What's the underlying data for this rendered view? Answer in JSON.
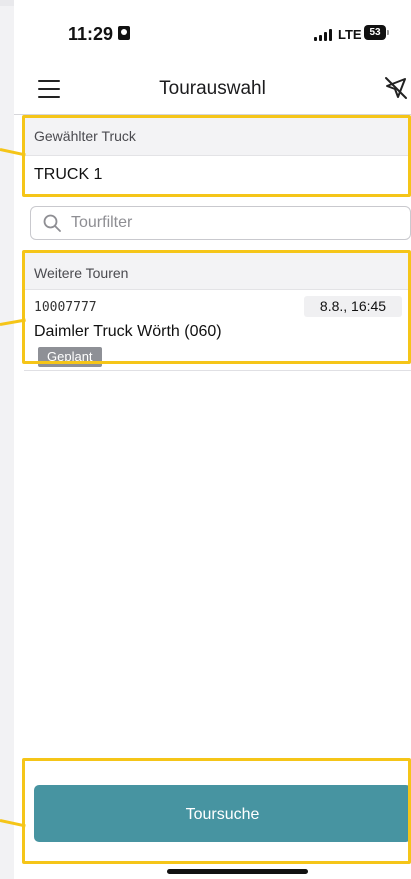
{
  "status_bar": {
    "time": "11:29",
    "network": "LTE",
    "battery": "53"
  },
  "app_bar": {
    "title": "Tourauswahl",
    "menu_icon": "menu-icon",
    "right_icon": "navigation-off-icon"
  },
  "truck_section": {
    "header": "Gewählter Truck",
    "value": "TRUCK 1"
  },
  "filter": {
    "placeholder": "Tourfilter",
    "value": "",
    "icon": "search-icon"
  },
  "tours_section": {
    "header": "Weitere Touren",
    "items": [
      {
        "number": "10007777",
        "date": "8.8., 16:45",
        "name": "Daimler Truck Wörth (060)",
        "status": "Geplant"
      }
    ]
  },
  "actions": {
    "search_label": "Toursuche"
  },
  "colors": {
    "accent": "#4794a1",
    "highlight": "#f5c518",
    "status_badge": "#8e9096"
  }
}
